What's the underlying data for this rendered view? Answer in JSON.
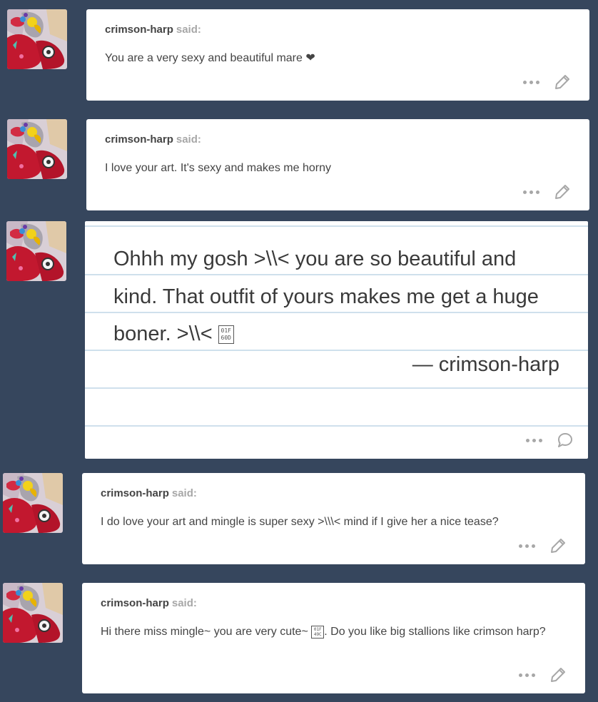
{
  "posts": [
    {
      "asker": "crimson-harp",
      "said": "said:",
      "question": "You are a very sexy and beautiful mare ❤"
    },
    {
      "asker": "crimson-harp",
      "said": "said:",
      "question": "I love your art. It's sexy and makes me horny"
    },
    {
      "note_text": "Ohhh my gosh >\\\\< you are so beautiful and kind. That outfit of yours makes me get a huge boner. >\\\\<",
      "note_glyph": "01F 60D",
      "note_signature": "— crimson-harp"
    },
    {
      "asker": "crimson-harp",
      "said": "said:",
      "question": "I do love your art and mingle is super sexy >\\\\\\< mind if I give her a nice tease?"
    },
    {
      "asker": "crimson-harp",
      "said": "said:",
      "question_before": "Hi there miss mingle~ you are very cute~",
      "question_glyph": "01F 49C",
      "question_after": ". Do you like big stallions like crimson harp?"
    }
  ],
  "icons": {
    "more": "more-dots-icon",
    "edit": "pencil-icon",
    "reply": "speech-bubble-icon",
    "avatar": "pony-avatar"
  },
  "colors": {
    "dashboard_bg": "#36465d",
    "card_bg": "#ffffff",
    "asker_text": "#444444",
    "said_text": "#a7a7a7",
    "icon_gray": "#a7a7a7",
    "note_lines": "#cfe0ec"
  }
}
